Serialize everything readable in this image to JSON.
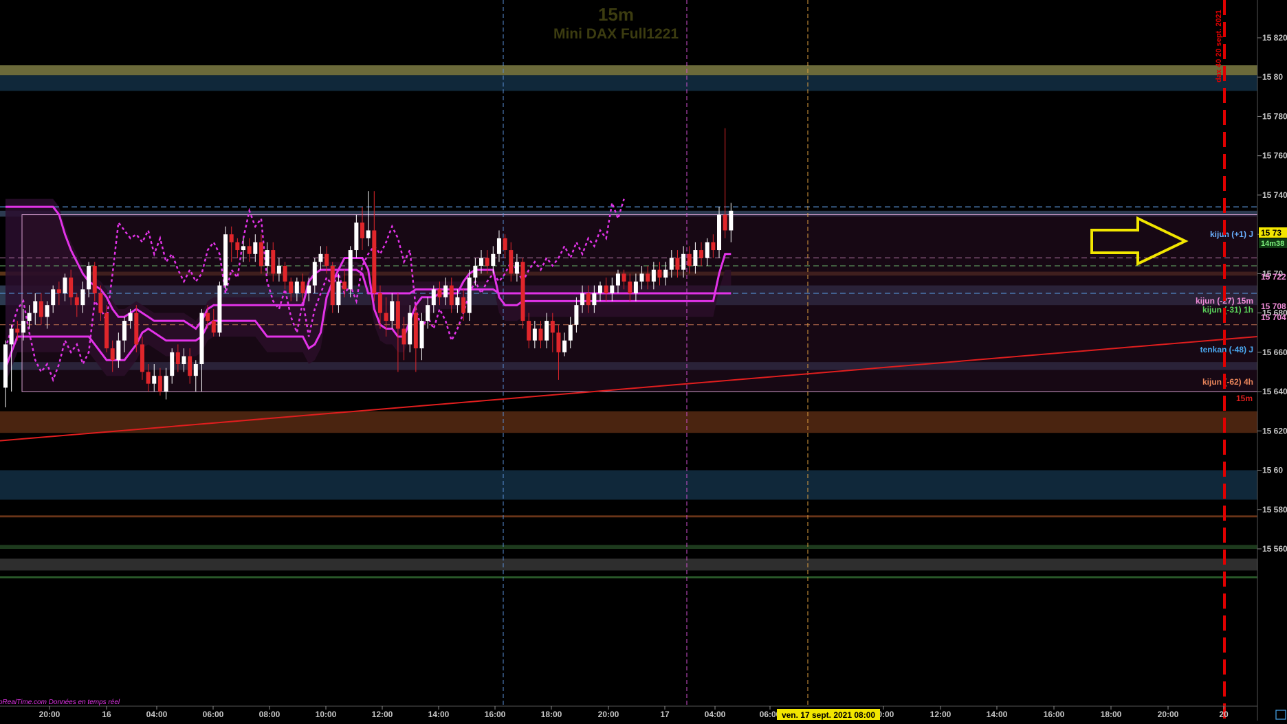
{
  "header": {
    "timeframe": "15m",
    "instrument": "Mini DAX Full1221"
  },
  "vertical_annotation": "dax 40 20 sept. 2021",
  "footer": {
    "source": "ProRealTime.com  Données en temps réel",
    "cursor_date": "ven. 17 sept. 2021 08:00"
  },
  "level_labels": {
    "kijun_plus1_d": "kijun (+1) J",
    "kijun_m27_15m": "kijun (-27) 15m",
    "kijun_m31_1h": "kijun (-31) 1h",
    "tenkan_m48_d": "tenkan (-48) J",
    "kijun_m62_4h": "kijun (-62) 4h",
    "trend_label": "15m"
  },
  "price_tags": {
    "current": "15 73",
    "countdown": "14m38",
    "k15m": "15 722",
    "k1h_a": "15 708",
    "k1h_b": "15 704"
  },
  "colors": {
    "background": "#000000",
    "bull_candle": "#ffffff",
    "bear_candle": "#e0262b",
    "ichimoku": "#e233e8",
    "trendline": "#e01e1e",
    "arrow": "#f2e600",
    "session_line_blue": "#5a8fd8",
    "session_line_magenta": "#d050d0",
    "session_line_orange": "#e0a040",
    "target_line": "#e00000",
    "band_olive": "#6b6a3a",
    "band_navy": "#10283a",
    "band_brown": "#4a2410",
    "band_steel": "#2c3a50",
    "cloud_fill": "#2a0e2e"
  },
  "chart_data": {
    "type": "candlestick",
    "title": "Mini DAX Full1221",
    "timeframe": "15m",
    "y_axis": {
      "ticks": [
        15560,
        15580,
        15600,
        15620,
        15640,
        15660,
        15680,
        15700,
        15720,
        15740,
        15760,
        15780,
        15800,
        15820
      ],
      "tick_labels": [
        "15 560",
        "15 580",
        "15 60",
        "15 620",
        "15 640",
        "15 660",
        "15 680",
        "15 70",
        "15 720",
        "15 740",
        "15 760",
        "15 780",
        "15 80",
        "15 820"
      ],
      "range": [
        15536,
        15843
      ]
    },
    "x_axis": {
      "tick_labels": [
        "20:00",
        "16",
        "04:00",
        "06:00",
        "08:00",
        "10:00",
        "12:00",
        "14:00",
        "16:00",
        "18:00",
        "20:00",
        "17",
        "04:00",
        "06:00",
        "10:00",
        "12:00",
        "14:00",
        "16:00",
        "18:00",
        "20:00",
        "20"
      ]
    },
    "levels": {
      "kijun_plus1_d": 15734,
      "kijun_m27_15m": 15708,
      "kijun_m31_1h": 15704,
      "tenkan_m48_d": 15690,
      "kijun_m62_4h": 15674,
      "range_top": 15730,
      "range_bottom": 15640
    },
    "zones": [
      {
        "name": "upper-olive",
        "from": 15806,
        "to": 15801
      },
      {
        "name": "upper-navy",
        "from": 15801,
        "to": 15793
      },
      {
        "name": "resistance-steel",
        "from": 15732,
        "to": 15729
      },
      {
        "name": "brown-thin",
        "from": 15701,
        "to": 15699
      },
      {
        "name": "tenkan-steel",
        "from": 15694,
        "to": 15684
      },
      {
        "name": "support-steel",
        "from": 15655,
        "to": 15651
      },
      {
        "name": "brown-support",
        "from": 15630,
        "to": 15619
      },
      {
        "name": "navy-lower",
        "from": 15600,
        "to": 15585
      },
      {
        "name": "brown-line",
        "from": 15577,
        "to": 15576
      },
      {
        "name": "green-lower",
        "from": 15562,
        "to": 15560
      },
      {
        "name": "grey-lower",
        "from": 15555,
        "to": 15549
      },
      {
        "name": "green-lower-2",
        "from": 15546,
        "to": 15545
      }
    ],
    "trendline": {
      "start": 15615,
      "end": 15668
    },
    "candles": [
      [
        15642,
        15664,
        15632,
        15666
      ],
      [
        15664,
        15672,
        15640,
        15674
      ],
      [
        15672,
        15670,
        15666,
        15676
      ],
      [
        15670,
        15676,
        15666,
        15682
      ],
      [
        15676,
        15680,
        15672,
        15684
      ],
      [
        15680,
        15686,
        15674,
        15690
      ],
      [
        15686,
        15678,
        15674,
        15690
      ],
      [
        15678,
        15684,
        15672,
        15686
      ],
      [
        15684,
        15692,
        15680,
        15694
      ],
      [
        15692,
        15690,
        15684,
        15696
      ],
      [
        15690,
        15698,
        15686,
        15700
      ],
      [
        15698,
        15688,
        15684,
        15702
      ],
      [
        15688,
        15684,
        15678,
        15690
      ],
      [
        15684,
        15692,
        15680,
        15696
      ],
      [
        15692,
        15704,
        15688,
        15706
      ],
      [
        15704,
        15690,
        15686,
        15706
      ],
      [
        15690,
        15680,
        15676,
        15694
      ],
      [
        15680,
        15662,
        15660,
        15684
      ],
      [
        15662,
        15656,
        15650,
        15666
      ],
      [
        15656,
        15666,
        15652,
        15670
      ],
      [
        15666,
        15676,
        15660,
        15678
      ],
      [
        15676,
        15680,
        15672,
        15682
      ],
      [
        15680,
        15664,
        15660,
        15684
      ],
      [
        15664,
        15650,
        15646,
        15668
      ],
      [
        15650,
        15644,
        15640,
        15654
      ],
      [
        15644,
        15648,
        15640,
        15654
      ],
      [
        15648,
        15640,
        15638,
        15652
      ],
      [
        15640,
        15648,
        15636,
        15652
      ],
      [
        15648,
        15660,
        15644,
        15662
      ],
      [
        15660,
        15654,
        15650,
        15664
      ],
      [
        15654,
        15658,
        15650,
        15662
      ],
      [
        15658,
        15648,
        15644,
        15662
      ],
      [
        15648,
        15654,
        15640,
        15656
      ],
      [
        15654,
        15680,
        15640,
        15682
      ],
      [
        15680,
        15676,
        15672,
        15684
      ],
      [
        15676,
        15670,
        15668,
        15682
      ],
      [
        15670,
        15694,
        15668,
        15696
      ],
      [
        15694,
        15720,
        15692,
        15724
      ],
      [
        15720,
        15716,
        15706,
        15724
      ],
      [
        15716,
        15712,
        15708,
        15718
      ],
      [
        15712,
        15714,
        15706,
        15718
      ],
      [
        15714,
        15710,
        15706,
        15718
      ],
      [
        15710,
        15716,
        15706,
        15720
      ],
      [
        15716,
        15704,
        15700,
        15720
      ],
      [
        15704,
        15712,
        15700,
        15716
      ],
      [
        15712,
        15700,
        15696,
        15716
      ],
      [
        15700,
        15704,
        15696,
        15708
      ],
      [
        15704,
        15696,
        15692,
        15706
      ],
      [
        15696,
        15690,
        15686,
        15698
      ],
      [
        15690,
        15696,
        15686,
        15698
      ],
      [
        15696,
        15690,
        15686,
        15700
      ],
      [
        15690,
        15694,
        15686,
        15698
      ],
      [
        15694,
        15706,
        15690,
        15708
      ],
      [
        15706,
        15710,
        15702,
        15714
      ],
      [
        15710,
        15704,
        15700,
        15714
      ],
      [
        15704,
        15684,
        15680,
        15706
      ],
      [
        15684,
        15696,
        15680,
        15700
      ],
      [
        15696,
        15692,
        15688,
        15702
      ],
      [
        15692,
        15712,
        15688,
        15714
      ],
      [
        15712,
        15726,
        15708,
        15730
      ],
      [
        15726,
        15718,
        15712,
        15734
      ],
      [
        15718,
        15722,
        15714,
        15742
      ],
      [
        15722,
        15690,
        15686,
        15742
      ],
      [
        15690,
        15680,
        15672,
        15694
      ],
      [
        15680,
        15676,
        15668,
        15688
      ],
      [
        15676,
        15686,
        15672,
        15690
      ],
      [
        15686,
        15672,
        15650,
        15690
      ],
      [
        15672,
        15664,
        15656,
        15678
      ],
      [
        15664,
        15680,
        15660,
        15684
      ],
      [
        15680,
        15662,
        15650,
        15684
      ],
      [
        15662,
        15676,
        15656,
        15680
      ],
      [
        15676,
        15684,
        15672,
        15688
      ],
      [
        15684,
        15692,
        15680,
        15694
      ],
      [
        15692,
        15688,
        15684,
        15696
      ],
      [
        15688,
        15694,
        15684,
        15698
      ],
      [
        15694,
        15684,
        15680,
        15698
      ],
      [
        15684,
        15688,
        15680,
        15692
      ],
      [
        15688,
        15680,
        15676,
        15692
      ],
      [
        15680,
        15698,
        15676,
        15702
      ],
      [
        15698,
        15704,
        15694,
        15708
      ],
      [
        15704,
        15708,
        15700,
        15712
      ],
      [
        15708,
        15704,
        15700,
        15712
      ],
      [
        15704,
        15710,
        15700,
        15714
      ],
      [
        15710,
        15718,
        15706,
        15722
      ],
      [
        15718,
        15712,
        15708,
        15720
      ],
      [
        15712,
        15700,
        15696,
        15716
      ],
      [
        15700,
        15706,
        15696,
        15710
      ],
      [
        15706,
        15676,
        15672,
        15708
      ],
      [
        15676,
        15666,
        15662,
        15680
      ],
      [
        15666,
        15672,
        15662,
        15676
      ],
      [
        15672,
        15666,
        15662,
        15676
      ],
      [
        15666,
        15676,
        15662,
        15680
      ],
      [
        15676,
        15670,
        15660,
        15680
      ],
      [
        15670,
        15660,
        15646,
        15674
      ],
      [
        15660,
        15666,
        15658,
        15670
      ],
      [
        15666,
        15674,
        15662,
        15678
      ],
      [
        15674,
        15684,
        15670,
        15688
      ],
      [
        15684,
        15690,
        15680,
        15694
      ],
      [
        15690,
        15684,
        15680,
        15694
      ],
      [
        15684,
        15690,
        15680,
        15694
      ],
      [
        15690,
        15694,
        15686,
        15696
      ],
      [
        15694,
        15690,
        15686,
        15698
      ],
      [
        15690,
        15694,
        15686,
        15698
      ],
      [
        15694,
        15700,
        15690,
        15702
      ],
      [
        15700,
        15696,
        15692,
        15702
      ],
      [
        15696,
        15690,
        15686,
        15700
      ],
      [
        15690,
        15696,
        15686,
        15700
      ],
      [
        15696,
        15700,
        15692,
        15704
      ],
      [
        15700,
        15696,
        15692,
        15704
      ],
      [
        15696,
        15702,
        15692,
        15706
      ],
      [
        15702,
        15698,
        15694,
        15706
      ],
      [
        15698,
        15702,
        15694,
        15706
      ],
      [
        15702,
        15708,
        15698,
        15712
      ],
      [
        15708,
        15702,
        15698,
        15712
      ],
      [
        15702,
        15710,
        15698,
        15714
      ],
      [
        15710,
        15704,
        15700,
        15714
      ],
      [
        15704,
        15712,
        15700,
        15716
      ],
      [
        15712,
        15708,
        15704,
        15716
      ],
      [
        15708,
        15716,
        15704,
        15718
      ],
      [
        15716,
        15712,
        15708,
        15720
      ],
      [
        15712,
        15730,
        15708,
        15734
      ],
      [
        15730,
        15722,
        15718,
        15774
      ],
      [
        15722,
        15732,
        15716,
        15736
      ]
    ],
    "ichimoku": {
      "kijun": [
        15734,
        15734,
        15734,
        15734,
        15734,
        15734,
        15734,
        15734,
        15734,
        15730,
        15720,
        15712,
        15706,
        15700,
        15696,
        15694,
        15692,
        15688,
        15682,
        15678,
        15678,
        15680,
        15682,
        15680,
        15678,
        15676,
        15676,
        15676,
        15676,
        15676,
        15676,
        15674,
        15672,
        15676,
        15682,
        15684,
        15684,
        15684,
        15684,
        15684,
        15684,
        15684,
        15684,
        15684,
        15684,
        15684,
        15684,
        15684,
        15684,
        15684,
        15684,
        15696,
        15700,
        15702,
        15702,
        15702,
        15702,
        15702,
        15702,
        15702,
        15700,
        15690,
        15690,
        15690,
        15690,
        15690,
        15690,
        15690,
        15690,
        15692,
        15692,
        15692,
        15692,
        15692,
        15692,
        15692,
        15692,
        15692,
        15692,
        15692,
        15692,
        15692,
        15692,
        15690,
        15690,
        15690,
        15690,
        15690,
        15690,
        15690,
        15690,
        15690,
        15690,
        15690,
        15690,
        15690,
        15690,
        15690,
        15690,
        15690,
        15690,
        15690,
        15690,
        15690,
        15690,
        15690,
        15690,
        15690,
        15690,
        15690,
        15690,
        15690,
        15690,
        15690,
        15690,
        15690,
        15690,
        15690,
        15690,
        15690,
        15690,
        15690,
        15690
      ],
      "tenkan": [
        15652,
        15660,
        15668,
        15668,
        15668,
        15668,
        15668,
        15668,
        15668,
        15668,
        15668,
        15668,
        15668,
        15668,
        15668,
        15664,
        15660,
        15656,
        15656,
        15656,
        15656,
        15660,
        15664,
        15670,
        15672,
        15670,
        15668,
        15666,
        15666,
        15666,
        15666,
        15666,
        15666,
        15668,
        15674,
        15676,
        15676,
        15676,
        15676,
        15676,
        15676,
        15676,
        15676,
        15672,
        15668,
        15668,
        15668,
        15668,
        15668,
        15668,
        15668,
        15662,
        15664,
        15670,
        15688,
        15696,
        15702,
        15708,
        15708,
        15708,
        15708,
        15702,
        15682,
        15674,
        15672,
        15672,
        15668,
        15668,
        15676,
        15684,
        15688,
        15688,
        15688,
        15690,
        15690,
        15690,
        15690,
        15696,
        15700,
        15702,
        15702,
        15702,
        15702,
        15688,
        15684,
        15684,
        15684,
        15686,
        15686,
        15686,
        15686,
        15686,
        15686,
        15686,
        15686,
        15686,
        15686,
        15686,
        15686,
        15686,
        15686,
        15686,
        15686,
        15686,
        15686,
        15686,
        15686,
        15686,
        15686,
        15686,
        15686,
        15686,
        15686,
        15686,
        15686,
        15686,
        15686,
        15686,
        15686,
        15686,
        15700,
        15710,
        15710
      ]
    }
  }
}
